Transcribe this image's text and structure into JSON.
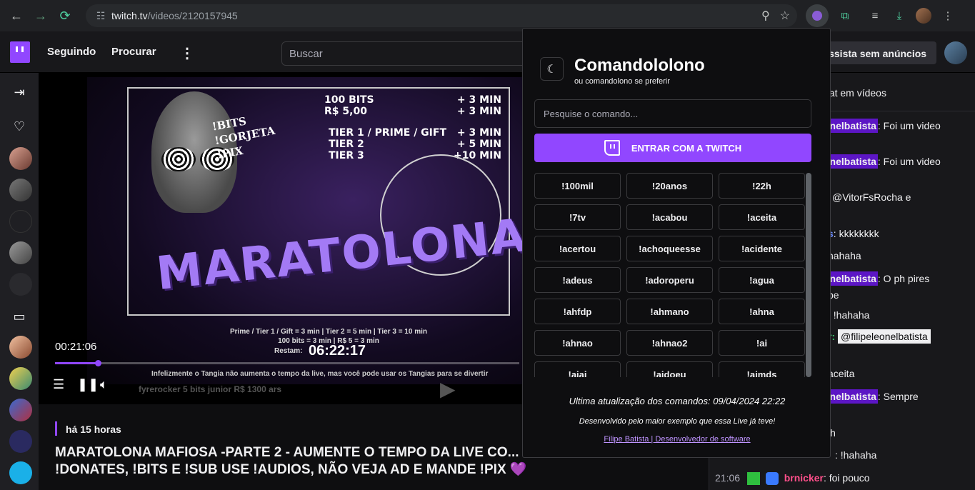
{
  "browser": {
    "url_host": "twitch.tv",
    "url_path": "/videos/2120157945"
  },
  "header": {
    "following": "Seguindo",
    "browse": "Procurar",
    "search_placeholder": "Buscar",
    "ads_button": "Assista sem anúncios"
  },
  "player": {
    "current_time": "00:21:06",
    "progress_fraction": 0.09,
    "thumb": {
      "big_text": "MARATOLONA",
      "tags": [
        "!BITS",
        "!GORJETA",
        "!PIX"
      ],
      "prices": [
        "100 BITS",
        "R$ 5,00",
        "TIER 1 / PRIME / GIFT",
        "TIER 2",
        "TIER 3"
      ],
      "plus": [
        "+ 3 MIN",
        "+ 3 MIN",
        "+ 3 MIN",
        "+ 5 MIN",
        "+10 MIN"
      ],
      "info1": "Prime / Tier 1 / Gift = 3 min | Tier 2 = 5 min | Tier 3 = 10 min",
      "info2": "100 bits = 3 min | R$ 5 = 3 min",
      "restam_label": "Restam:",
      "restam_time": "06:22:17",
      "note": "Infelizmente o Tangia não aumenta o tempo da live, mas você pode usar os Tangias para se divertir",
      "ticker": "fyrerocker  5 bits   junior  R$ 1300   ars"
    }
  },
  "meta": {
    "ago": "há 15 horas",
    "title": "MARATOLONA MAFIOSA -PARTE 2 - AUMENTE O TEMPO DA LIVE CO... !DONATES, !BITS E !SUB USE !AUDIOS, NÃO VEJA AD E MANDE !PIX 💜"
  },
  "chat": {
    "header": "hat em vídeos",
    "lines": [
      {
        "user": "onelbatista",
        "text": ": Foi um video"
      },
      {
        "user": "onelbatista",
        "text": ": Foi um video"
      },
      {
        "text": "@VitorFsRocha e"
      },
      {
        "text": ": kkkkkkkk"
      },
      {
        "text": "hahaha"
      },
      {
        "user": "onelbatista",
        "text": ": O ph pires"
      },
      {
        "text": "pe"
      },
      {
        "text": ": !hahaha"
      },
      {
        "text": "@filipeleonelbatista"
      },
      {
        "text": "aceita"
      },
      {
        "user": "onelbatista",
        "text": ": Sempre"
      },
      {
        "text": "ih"
      },
      {
        "text": ": !hahaha"
      },
      {
        "time": "21:06",
        "user": "brnicker",
        "text": ": foi pouco"
      }
    ]
  },
  "popup": {
    "title": "Comandololono",
    "subtitle": "ou comandolono se preferir",
    "search_placeholder": "Pesquise o comando...",
    "login_label": "ENTRAR COM A TWITCH",
    "commands": [
      "!100mil",
      "!20anos",
      "!22h",
      "!7tv",
      "!acabou",
      "!aceita",
      "!acertou",
      "!achoqueesse",
      "!acidente",
      "!adeus",
      "!adoroperu",
      "!agua",
      "!ahfdp",
      "!ahmano",
      "!ahna",
      "!ahnao",
      "!ahnao2",
      "!ai",
      "!aiai",
      "!aidoeu",
      "!aimds"
    ],
    "updated": "Ultima atualização dos comandos: 09/04/2024 22:22",
    "developed": "Desenvolvido pelo maior exemplo que essa Live já teve!",
    "link": "Filipe Batista | Desenvolvedor de software"
  },
  "colors": {
    "accent": "#9147ff",
    "background": "#0e0e10"
  }
}
